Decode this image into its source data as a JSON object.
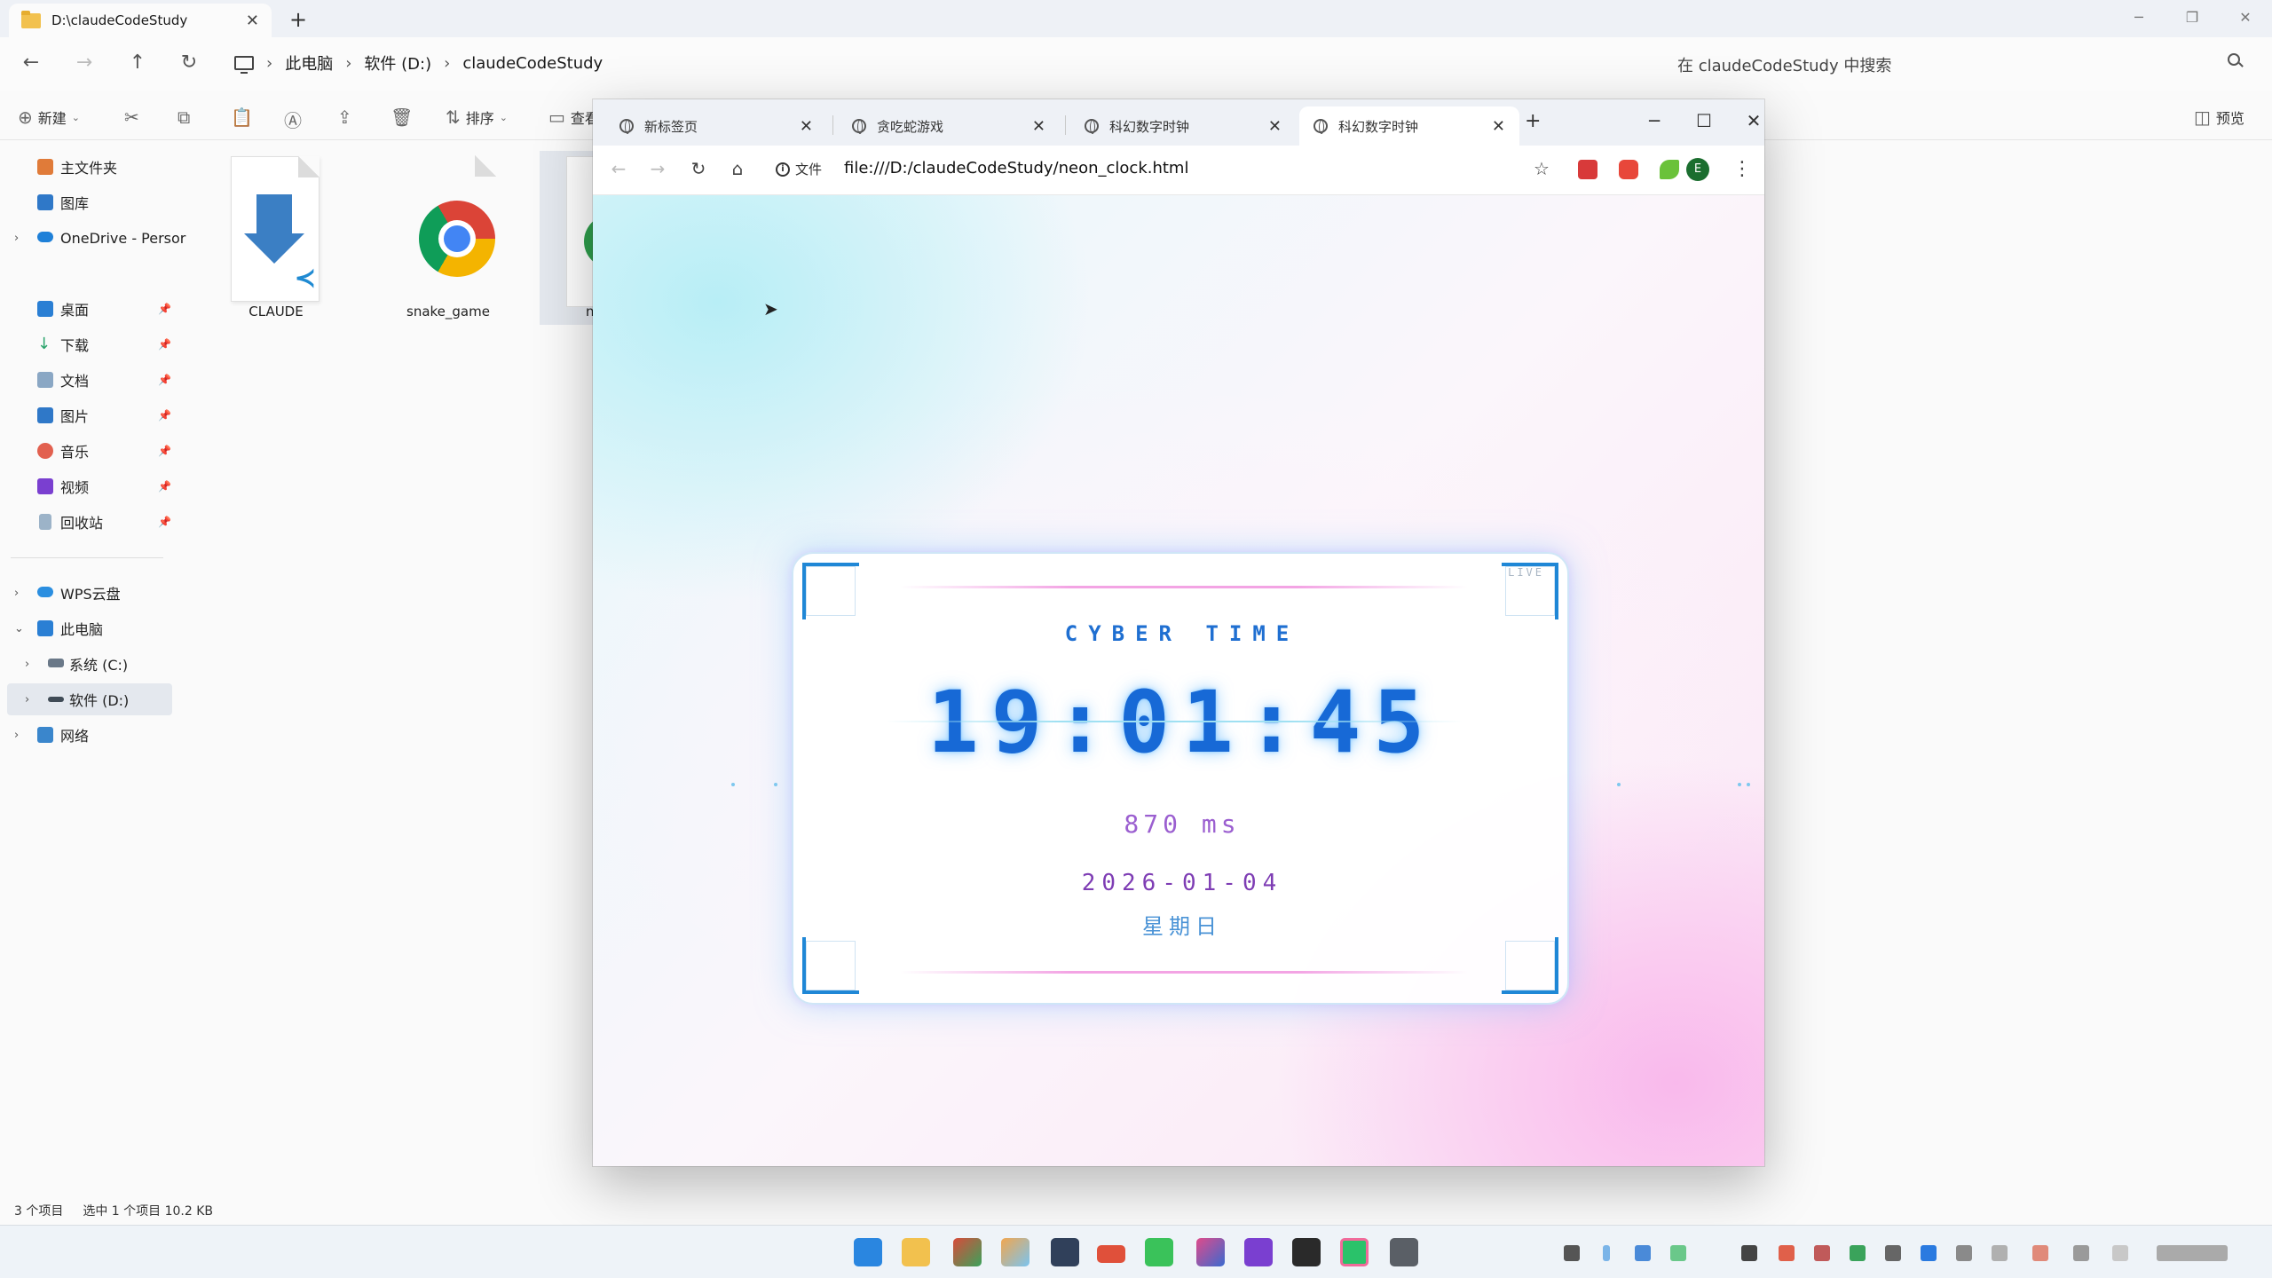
{
  "explorer": {
    "tab_title": "D:\\claudeCodeStudy",
    "new_tab": "+",
    "breadcrumb": [
      "此电脑",
      "软件 (D:)",
      "claudeCodeStudy"
    ],
    "search_placeholder": "在 claudeCodeStudy 中搜索",
    "toolbar": {
      "new_label": "新建",
      "sort_label": "排序",
      "view_label": "查看",
      "preview_label": "预览"
    },
    "nav": {
      "home": "主文件夹",
      "gallery": "图库",
      "onedrive": "OneDrive - Persor",
      "desktop": "桌面",
      "downloads": "下载",
      "documents": "文档",
      "pictures": "图片",
      "music": "音乐",
      "videos": "视频",
      "recycle": "回收站",
      "wps": "WPS云盘",
      "this_pc": "此电脑",
      "drive_c": "系统 (C:)",
      "drive_d": "软件 (D:)",
      "network": "网络"
    },
    "files": [
      "CLAUDE",
      "snake_game",
      "n"
    ],
    "status": {
      "count": "3 个项目",
      "selection": "选中 1 个项目  10.2 KB"
    }
  },
  "chrome": {
    "tabs": [
      {
        "label": "新标签页",
        "active": false
      },
      {
        "label": "贪吃蛇游戏",
        "active": false
      },
      {
        "label": "科幻数字时钟",
        "active": false
      },
      {
        "label": "科幻数字时钟",
        "active": true
      }
    ],
    "url_prefix": "文件",
    "url": "file:///D:/claudeCodeStudy/neon_clock.html",
    "profile_initial": "E"
  },
  "clock": {
    "live_tag": "LIVE",
    "title": "CYBER TIME",
    "time": "19:01:45",
    "ms": "870 ms",
    "date": "2026-01-04",
    "weekday": "星期日",
    "accent_color": "#1769d6",
    "ms_color": "#9b5fd0"
  }
}
